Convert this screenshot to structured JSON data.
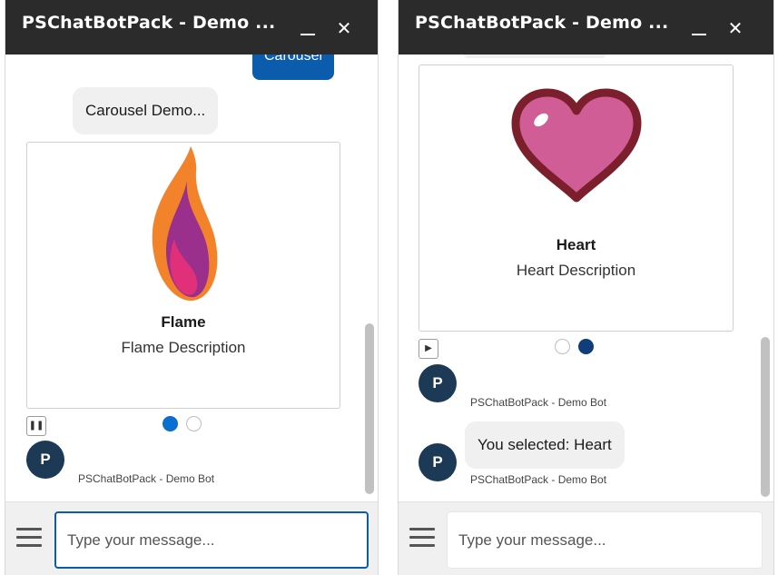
{
  "windows": [
    {
      "title": "PSChatBotPack - Demo ...",
      "messages": {
        "user_text": "Carousel",
        "bot_text": "Carousel Demo..."
      },
      "card": {
        "icon": "flame-icon",
        "title": "Flame",
        "description": "Flame Description"
      },
      "carousel": {
        "slide_count": 2,
        "active_index": 0,
        "control": "pause",
        "control_glyph": "❚❚"
      },
      "avatar_letter": "P",
      "sender": "PSChatBotPack - Demo Bot",
      "input": {
        "placeholder": "Type your message...",
        "value": ""
      }
    },
    {
      "title": "PSChatBotPack - Demo ...",
      "card": {
        "icon": "heart-icon",
        "title": "Heart",
        "description": "Heart Description"
      },
      "carousel": {
        "slide_count": 2,
        "active_index": 1,
        "control": "play",
        "control_glyph": "▶"
      },
      "avatar_letter": "P",
      "sender_1": "PSChatBotPack - Demo Bot",
      "reply": "You selected: Heart",
      "sender_2": "PSChatBotPack - Demo Bot",
      "input": {
        "placeholder": "Type your message...",
        "value": ""
      }
    }
  ],
  "colors": {
    "titlebar": "#2b2b2b",
    "user_bubble": "#0b5cad",
    "avatar": "#1c3a56",
    "dot_active_left": "#0b6fd0",
    "dot_active_right": "#0f3e7a",
    "heart_fill": "#d15d97",
    "heart_outline": "#7a1f2b",
    "flame_outer": "#f2832a",
    "flame_inner": "#9b2f8c"
  }
}
